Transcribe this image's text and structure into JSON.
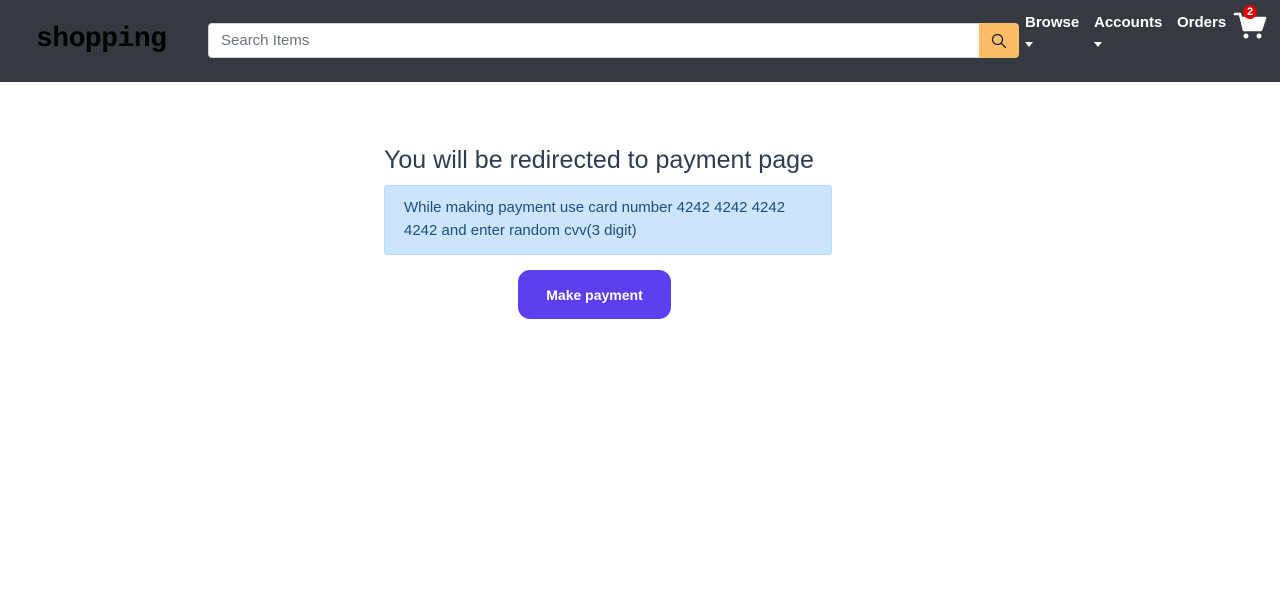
{
  "header": {
    "brand": "shopping",
    "search": {
      "placeholder": "Search Items",
      "value": ""
    },
    "nav": {
      "browse_label": "Browse",
      "accounts_label": "Accounts",
      "orders_label": "Orders"
    },
    "cart": {
      "count": "2"
    }
  },
  "main": {
    "title": "You will be redirected to payment page",
    "notice": "While making payment use card number 4242 4242 4242 4242 and enter random cvv(3 digit)",
    "pay_button_label": "Make payment"
  },
  "colors": {
    "navbar_bg": "#343a40",
    "search_button_bg": "#febd69",
    "alert_bg": "#cce4fc",
    "pay_button_bg": "#5b3ff0",
    "cart_badge": "#e00000"
  },
  "icons": {
    "search": "search-icon",
    "cart": "cart-icon",
    "dropdown": "caret-down-icon"
  }
}
